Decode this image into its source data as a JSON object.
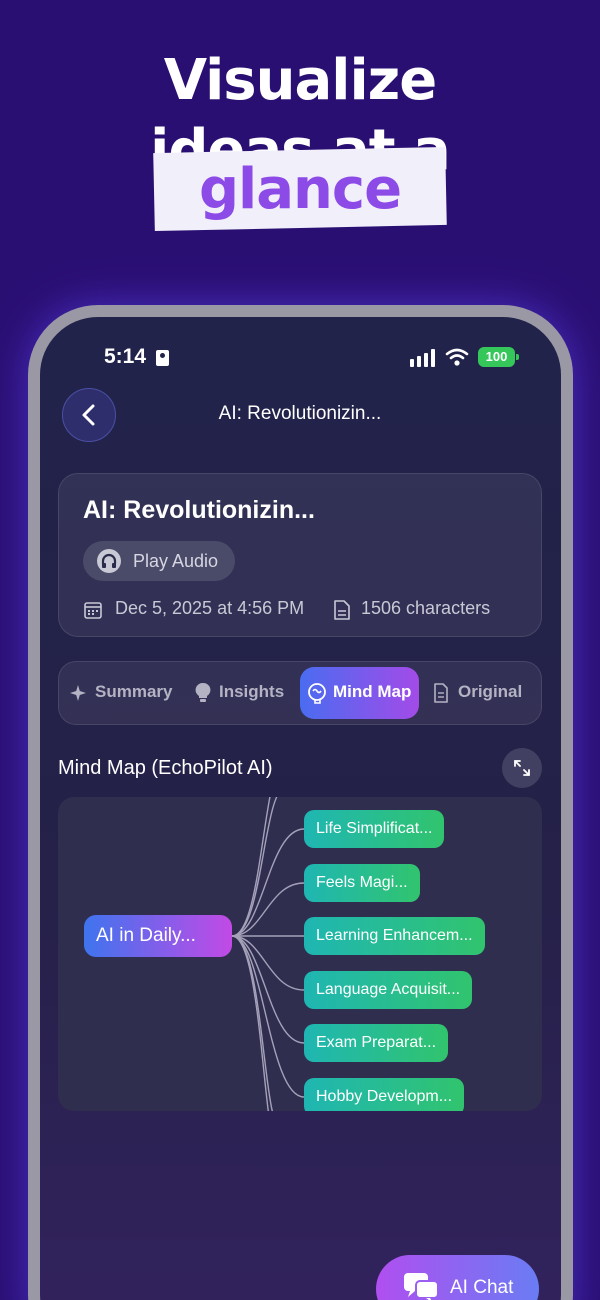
{
  "hero": {
    "line1": "Visualize",
    "line2": "ideas at a",
    "highlight": "glance",
    "colors": {
      "background": "#2a0f73",
      "highlight_text": "#8c4ae6",
      "highlight_bg": "#f1effa"
    }
  },
  "status_bar": {
    "time": "5:14",
    "battery": "100",
    "icons": [
      "id-card-icon",
      "signal-icon",
      "wifi-icon",
      "battery-icon"
    ]
  },
  "nav": {
    "back_icon": "chevron-left-icon",
    "title": "AI: Revolutionizin..."
  },
  "card": {
    "title": "AI: Revolutionizin...",
    "play_audio_label": "Play Audio",
    "date": "Dec 5, 2025 at 4:56 PM",
    "characters": "1506 characters",
    "icons": [
      "headphones-icon",
      "calendar-icon",
      "document-icon"
    ]
  },
  "tabs": [
    {
      "label": "Summary",
      "icon": "sparkle-icon",
      "active": false
    },
    {
      "label": "Insights",
      "icon": "lightbulb-icon",
      "active": false
    },
    {
      "label": "Mind Map",
      "icon": "brain-icon",
      "active": true
    },
    {
      "label": "Original",
      "icon": "document-icon",
      "active": false
    }
  ],
  "mindmap": {
    "title": "Mind Map (EchoPilot AI)",
    "expand_icon": "expand-arrows-icon",
    "root": "AI in Daily...",
    "children": [
      "Life Simplificat...",
      "Feels Magi...",
      "Learning Enhancem...",
      "Language Acquisit...",
      "Exam Preparat...",
      "Hobby Developm..."
    ]
  },
  "fab": {
    "label": "AI Chat",
    "icon": "chat-bubbles-icon"
  }
}
